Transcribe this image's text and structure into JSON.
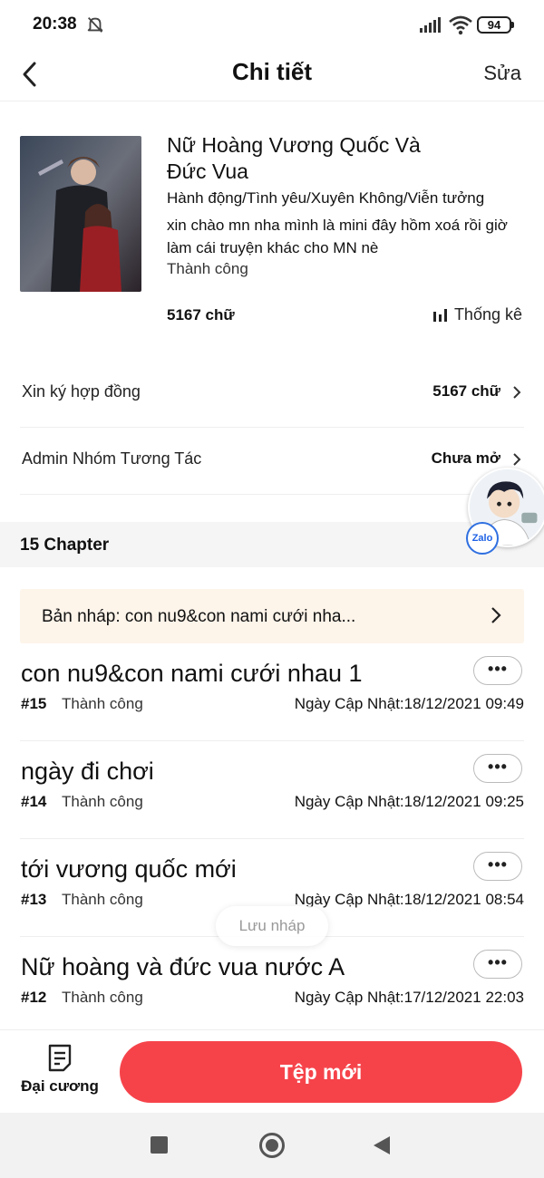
{
  "status_bar": {
    "time": "20:38",
    "battery": "94"
  },
  "nav": {
    "title": "Chi tiết",
    "edit_label": "Sửa"
  },
  "book": {
    "title": "Nữ Hoàng Vương Quốc Và Đức Vua",
    "genres": "Hành động/Tình yêu/Xuyên Không/Viễn tưởng",
    "description": "xin chào mn nha mình là mini đây hồm xoá rồi giờ làm cái truyện khác cho MN nè",
    "status": "Thành công",
    "word_count": "5167 chữ",
    "stats_label": "Thống kê"
  },
  "rows": {
    "contract": {
      "label": "Xin ký hợp đồng",
      "value": "5167 chữ"
    },
    "admin_group": {
      "label": "Admin Nhóm Tương Tác",
      "value": "Chưa mở"
    }
  },
  "chapters_header": {
    "count_label": "15 Chapter"
  },
  "zalo": {
    "badge": "Zalo"
  },
  "draft": {
    "text": "Bản nháp: con nu9&con nami cưới nha..."
  },
  "chapters": [
    {
      "title": "con nu9&con nami cưới nhau 1",
      "number": "#15",
      "status": "Thành công",
      "updated": "Ngày Cập Nhật:18/12/2021 09:49"
    },
    {
      "title": "ngày đi chơi",
      "number": "#14",
      "status": "Thành công",
      "updated": "Ngày Cập Nhật:18/12/2021 09:25"
    },
    {
      "title": "tới vương quốc mới",
      "number": "#13",
      "status": "Thành công",
      "updated": "Ngày Cập Nhật:18/12/2021 08:54"
    },
    {
      "title": "Nữ hoàng và đức vua nước A",
      "number": "#12",
      "status": "Thành công",
      "updated": "Ngày Cập Nhật:17/12/2021 22:03"
    }
  ],
  "more_label": "•••",
  "toast": "Lưu nháp",
  "bottom": {
    "outline_label": "Đại cương",
    "new_file_label": "Tệp mới"
  },
  "colors": {
    "primary_button": "#f6434a",
    "draft_background": "#fdf4ea",
    "section_background": "#f5f5f5"
  }
}
